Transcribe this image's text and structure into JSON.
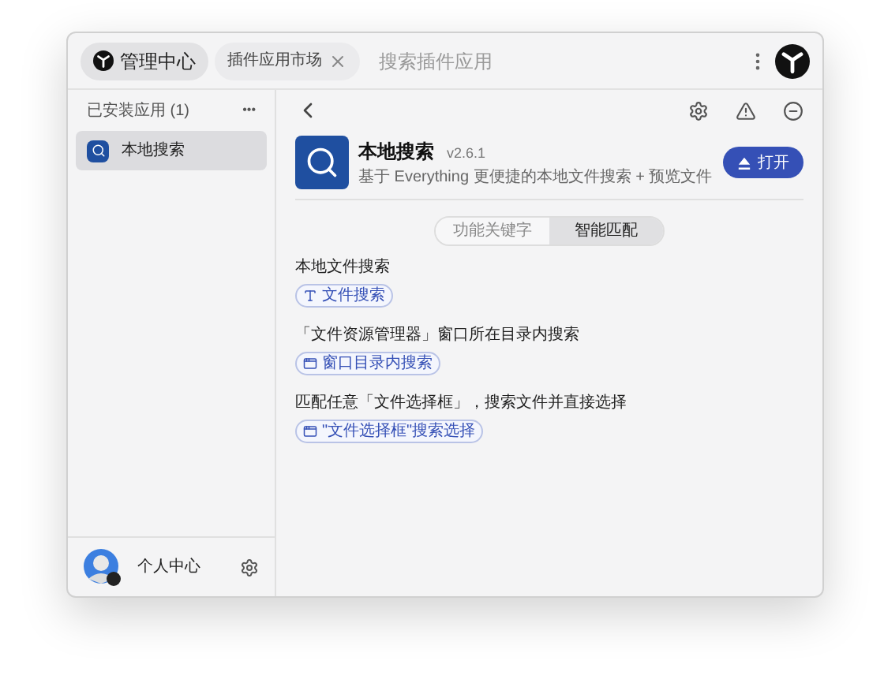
{
  "tabs": [
    {
      "label": "管理中心",
      "selected": true,
      "closable": false
    },
    {
      "label": "插件应用市场",
      "selected": false,
      "closable": true
    }
  ],
  "search": {
    "placeholder": "搜索插件应用"
  },
  "sidebar": {
    "heading": "已安装应用 (1)",
    "more": "•••",
    "items": [
      {
        "label": "本地搜索",
        "selected": true
      }
    ],
    "user": {
      "label": "个人中心"
    }
  },
  "plugin": {
    "name": "本地搜索",
    "version": "v2.6.1",
    "description": "基于 Everything 更便捷的本地文件搜索 + 预览文件",
    "open_button": "打开"
  },
  "segments": [
    {
      "label": "功能关键字",
      "selected": false
    },
    {
      "label": "智能匹配",
      "selected": true
    }
  ],
  "features": [
    {
      "title": "本地文件搜索",
      "tag": "文件搜索",
      "kind": "text"
    },
    {
      "title": "「文件资源管理器」窗口所在目录内搜索",
      "tag": "窗口目录内搜索",
      "kind": "window"
    },
    {
      "title": "匹配任意「文件选择框」，搜索文件并直接选择",
      "tag": "\"文件选择框\"搜索选择",
      "kind": "window"
    }
  ]
}
